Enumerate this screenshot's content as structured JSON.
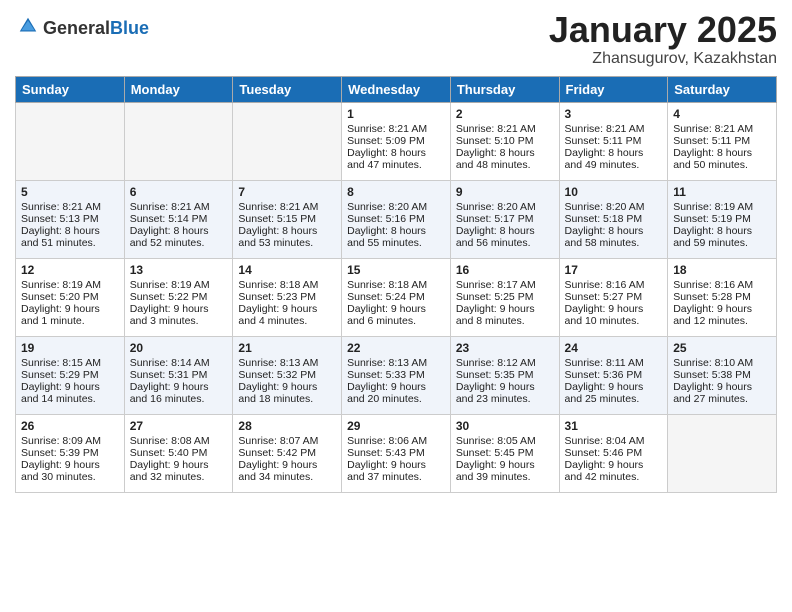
{
  "header": {
    "logo_line1": "General",
    "logo_line2": "Blue",
    "month": "January 2025",
    "location": "Zhansugurov, Kazakhstan"
  },
  "days_of_week": [
    "Sunday",
    "Monday",
    "Tuesday",
    "Wednesday",
    "Thursday",
    "Friday",
    "Saturday"
  ],
  "weeks": [
    [
      {
        "day": "",
        "info": "",
        "empty": true
      },
      {
        "day": "",
        "info": "",
        "empty": true
      },
      {
        "day": "",
        "info": "",
        "empty": true
      },
      {
        "day": "1",
        "info": "Sunrise: 8:21 AM\nSunset: 5:09 PM\nDaylight: 8 hours and 47 minutes."
      },
      {
        "day": "2",
        "info": "Sunrise: 8:21 AM\nSunset: 5:10 PM\nDaylight: 8 hours and 48 minutes."
      },
      {
        "day": "3",
        "info": "Sunrise: 8:21 AM\nSunset: 5:11 PM\nDaylight: 8 hours and 49 minutes."
      },
      {
        "day": "4",
        "info": "Sunrise: 8:21 AM\nSunset: 5:11 PM\nDaylight: 8 hours and 50 minutes."
      }
    ],
    [
      {
        "day": "5",
        "info": "Sunrise: 8:21 AM\nSunset: 5:13 PM\nDaylight: 8 hours and 51 minutes."
      },
      {
        "day": "6",
        "info": "Sunrise: 8:21 AM\nSunset: 5:14 PM\nDaylight: 8 hours and 52 minutes."
      },
      {
        "day": "7",
        "info": "Sunrise: 8:21 AM\nSunset: 5:15 PM\nDaylight: 8 hours and 53 minutes."
      },
      {
        "day": "8",
        "info": "Sunrise: 8:20 AM\nSunset: 5:16 PM\nDaylight: 8 hours and 55 minutes."
      },
      {
        "day": "9",
        "info": "Sunrise: 8:20 AM\nSunset: 5:17 PM\nDaylight: 8 hours and 56 minutes."
      },
      {
        "day": "10",
        "info": "Sunrise: 8:20 AM\nSunset: 5:18 PM\nDaylight: 8 hours and 58 minutes."
      },
      {
        "day": "11",
        "info": "Sunrise: 8:19 AM\nSunset: 5:19 PM\nDaylight: 8 hours and 59 minutes."
      }
    ],
    [
      {
        "day": "12",
        "info": "Sunrise: 8:19 AM\nSunset: 5:20 PM\nDaylight: 9 hours and 1 minute."
      },
      {
        "day": "13",
        "info": "Sunrise: 8:19 AM\nSunset: 5:22 PM\nDaylight: 9 hours and 3 minutes."
      },
      {
        "day": "14",
        "info": "Sunrise: 8:18 AM\nSunset: 5:23 PM\nDaylight: 9 hours and 4 minutes."
      },
      {
        "day": "15",
        "info": "Sunrise: 8:18 AM\nSunset: 5:24 PM\nDaylight: 9 hours and 6 minutes."
      },
      {
        "day": "16",
        "info": "Sunrise: 8:17 AM\nSunset: 5:25 PM\nDaylight: 9 hours and 8 minutes."
      },
      {
        "day": "17",
        "info": "Sunrise: 8:16 AM\nSunset: 5:27 PM\nDaylight: 9 hours and 10 minutes."
      },
      {
        "day": "18",
        "info": "Sunrise: 8:16 AM\nSunset: 5:28 PM\nDaylight: 9 hours and 12 minutes."
      }
    ],
    [
      {
        "day": "19",
        "info": "Sunrise: 8:15 AM\nSunset: 5:29 PM\nDaylight: 9 hours and 14 minutes."
      },
      {
        "day": "20",
        "info": "Sunrise: 8:14 AM\nSunset: 5:31 PM\nDaylight: 9 hours and 16 minutes."
      },
      {
        "day": "21",
        "info": "Sunrise: 8:13 AM\nSunset: 5:32 PM\nDaylight: 9 hours and 18 minutes."
      },
      {
        "day": "22",
        "info": "Sunrise: 8:13 AM\nSunset: 5:33 PM\nDaylight: 9 hours and 20 minutes."
      },
      {
        "day": "23",
        "info": "Sunrise: 8:12 AM\nSunset: 5:35 PM\nDaylight: 9 hours and 23 minutes."
      },
      {
        "day": "24",
        "info": "Sunrise: 8:11 AM\nSunset: 5:36 PM\nDaylight: 9 hours and 25 minutes."
      },
      {
        "day": "25",
        "info": "Sunrise: 8:10 AM\nSunset: 5:38 PM\nDaylight: 9 hours and 27 minutes."
      }
    ],
    [
      {
        "day": "26",
        "info": "Sunrise: 8:09 AM\nSunset: 5:39 PM\nDaylight: 9 hours and 30 minutes."
      },
      {
        "day": "27",
        "info": "Sunrise: 8:08 AM\nSunset: 5:40 PM\nDaylight: 9 hours and 32 minutes."
      },
      {
        "day": "28",
        "info": "Sunrise: 8:07 AM\nSunset: 5:42 PM\nDaylight: 9 hours and 34 minutes."
      },
      {
        "day": "29",
        "info": "Sunrise: 8:06 AM\nSunset: 5:43 PM\nDaylight: 9 hours and 37 minutes."
      },
      {
        "day": "30",
        "info": "Sunrise: 8:05 AM\nSunset: 5:45 PM\nDaylight: 9 hours and 39 minutes."
      },
      {
        "day": "31",
        "info": "Sunrise: 8:04 AM\nSunset: 5:46 PM\nDaylight: 9 hours and 42 minutes."
      },
      {
        "day": "",
        "info": "",
        "empty": true
      }
    ]
  ]
}
